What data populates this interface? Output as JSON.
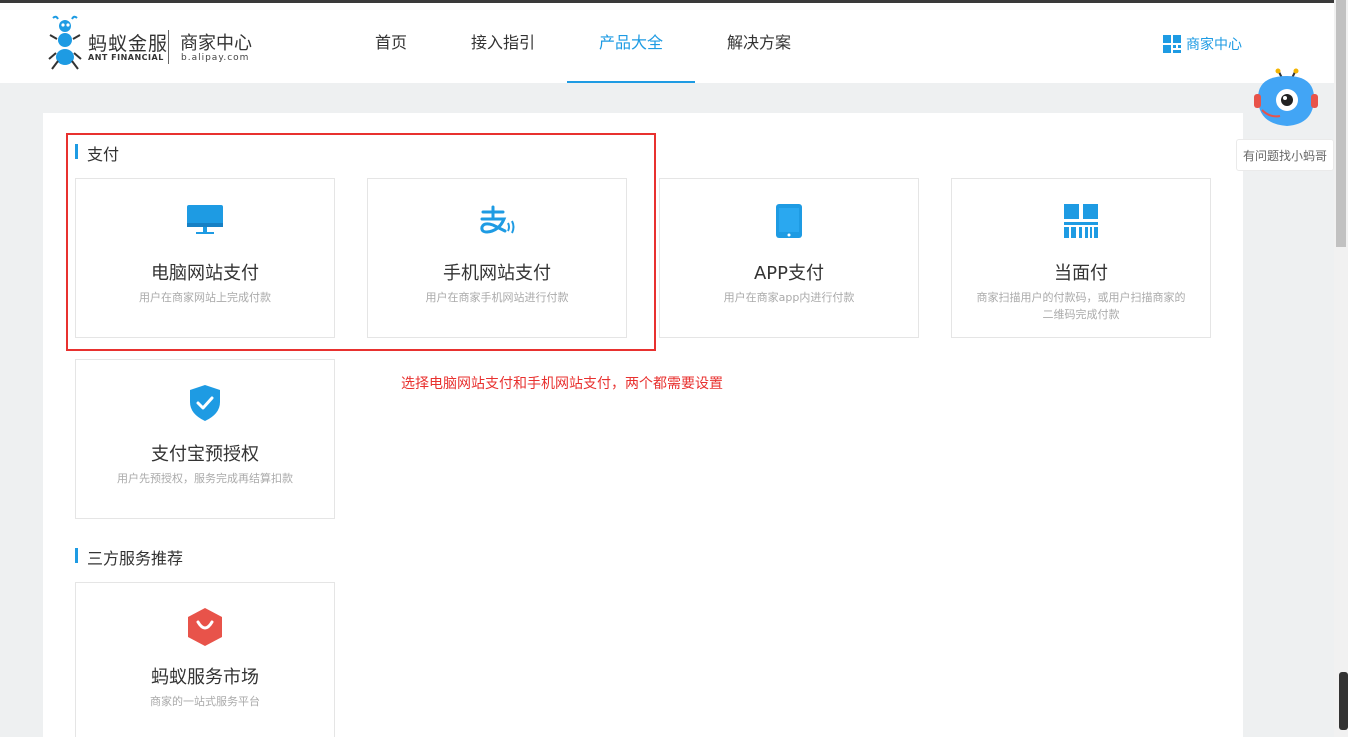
{
  "header": {
    "logo_cn": "蚂蚁金服",
    "logo_en": "ANT FINANCIAL",
    "logo_sub_cn": "商家中心",
    "logo_sub_en": "b.alipay.com",
    "nav": [
      {
        "label": "首页"
      },
      {
        "label": "接入指引"
      },
      {
        "label": "产品大全"
      },
      {
        "label": "解决方案"
      }
    ],
    "active_nav": "产品大全",
    "merchant_link": "商家中心"
  },
  "sections": {
    "payment": {
      "title": "支付",
      "cards": [
        {
          "title": "电脑网站支付",
          "desc": "用户在商家网站上完成付款",
          "icon": "desktop-icon"
        },
        {
          "title": "手机网站支付",
          "desc": "用户在商家手机网站进行付款",
          "icon": "alipay-icon"
        },
        {
          "title": "APP支付",
          "desc": "用户在商家app内进行付款",
          "icon": "phone-icon"
        },
        {
          "title": "当面付",
          "desc": "商家扫描用户的付款码，或用户扫描商家的二维码完成付款",
          "icon": "qrcode-icon"
        },
        {
          "title": "支付宝预授权",
          "desc": "用户先预授权，服务完成再结算扣款",
          "icon": "shield-check-icon"
        }
      ]
    },
    "third_party": {
      "title": "三方服务推荐",
      "cards": [
        {
          "title": "蚂蚁服务市场",
          "desc": "商家的一站式服务平台",
          "icon": "shopping-bag-icon"
        }
      ]
    }
  },
  "annotation": "选择电脑网站支付和手机网站支付，两个都需要设置",
  "help": {
    "label": "有问题找小蚂哥"
  },
  "colors": {
    "accent": "#1e9be3",
    "annotation_red": "#e8312f",
    "market_red": "#e8534a"
  }
}
